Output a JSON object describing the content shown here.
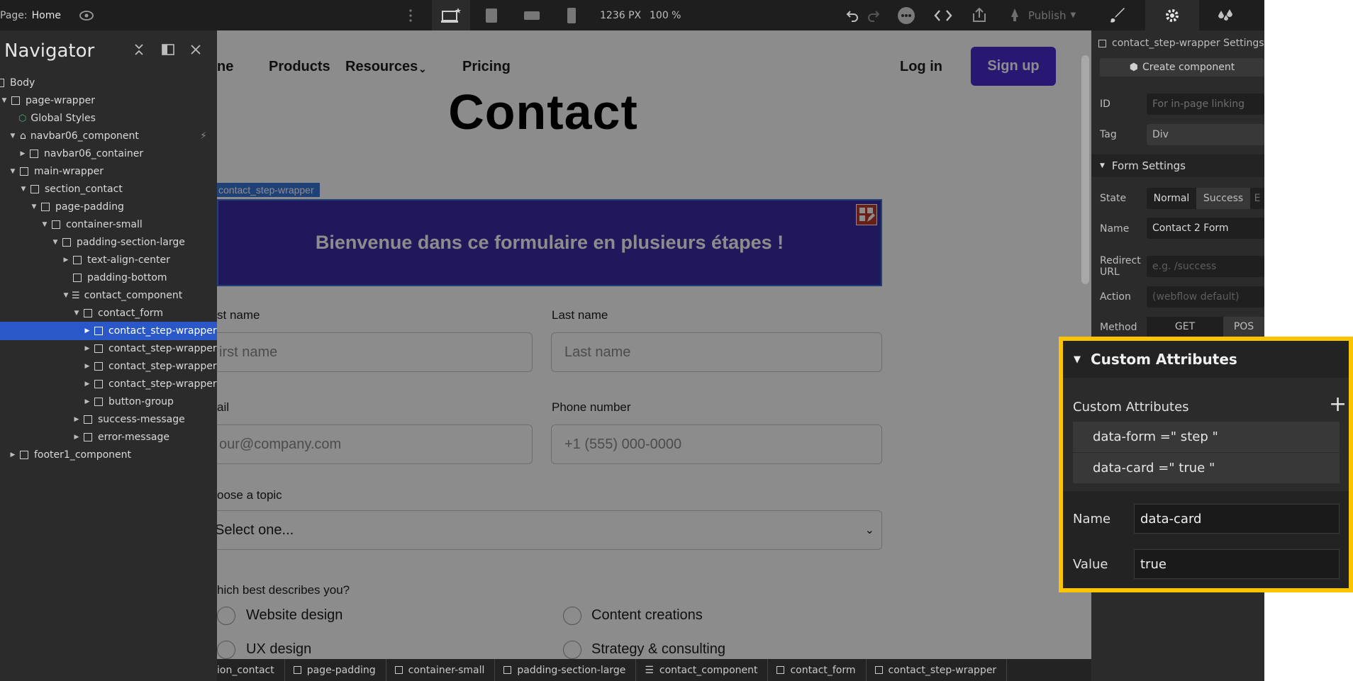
{
  "topbar": {
    "page_prefix": "Page:",
    "page_name": "Home",
    "width_label": "1236 PX",
    "zoom_label": "100 %",
    "publish_label": "Publish"
  },
  "navigator": {
    "title": "Navigator",
    "items": [
      {
        "label": "Body"
      },
      {
        "label": "page-wrapper"
      },
      {
        "label": "Global Styles"
      },
      {
        "label": "navbar06_component"
      },
      {
        "label": "navbar06_container"
      },
      {
        "label": "main-wrapper"
      },
      {
        "label": "section_contact"
      },
      {
        "label": "page-padding"
      },
      {
        "label": "container-small"
      },
      {
        "label": "padding-section-large"
      },
      {
        "label": "text-align-center"
      },
      {
        "label": "padding-bottom"
      },
      {
        "label": "contact_component"
      },
      {
        "label": "contact_form"
      },
      {
        "label": "contact_step-wrapper"
      },
      {
        "label": "contact_step-wrapper"
      },
      {
        "label": "contact_step-wrapper"
      },
      {
        "label": "contact_step-wrapper"
      },
      {
        "label": "button-group"
      },
      {
        "label": "success-message"
      },
      {
        "label": "error-message"
      },
      {
        "label": "footer1_component"
      }
    ]
  },
  "canvas": {
    "nav": {
      "home_partial": "ne",
      "products": "Products",
      "resources": "Resources",
      "pricing": "Pricing",
      "login": "Log in",
      "signup": "Sign up"
    },
    "heading": "Contact",
    "selected_tag": "contact_step-wrapper",
    "step_text": "Bienvenue dans ce formulaire en plusieurs étapes !",
    "first_name_label": "st name",
    "first_name_placeholder": "irst name",
    "last_name_label": "Last name",
    "last_name_placeholder": "Last name",
    "email_label": "ail",
    "email_placeholder": "our@company.com",
    "phone_label": "Phone number",
    "phone_placeholder": "+1 (555) 000-0000",
    "topic_label": "oose a topic",
    "topic_value": "Select one...",
    "describe_label": "hich best describes you?",
    "radios": [
      "Website design",
      "Content creations",
      "UX design",
      "Strategy & consulting"
    ]
  },
  "breadcrumbs": [
    "ion_contact",
    "page-padding",
    "container-small",
    "padding-section-large",
    "contact_component",
    "contact_form",
    "contact_step-wrapper"
  ],
  "settings": {
    "element_title": "contact_step-wrapper Settings",
    "create_component": "Create component",
    "id_label": "ID",
    "id_placeholder": "For in-page linking",
    "tag_label": "Tag",
    "tag_value": "Div",
    "form_settings": "Form Settings",
    "state_label": "State",
    "state_normal": "Normal",
    "state_success": "Success",
    "state_more": "E",
    "name_label": "Name",
    "name_value": "Contact 2 Form",
    "redirect_label_1": "Redirect",
    "redirect_label_2": "URL",
    "redirect_placeholder": "e.g. /success",
    "action_label": "Action",
    "action_placeholder": "(webflow default)",
    "method_label": "Method",
    "method_get": "GET",
    "method_post": "POS"
  },
  "custom_attributes": {
    "header": "Custom Attributes",
    "list_label": "Custom Attributes",
    "attrs": [
      "data-form =\" step \"",
      "data-card =\" true \""
    ],
    "name_label": "Name",
    "name_value": "data-card",
    "value_label": "Value",
    "value_value": "true"
  },
  "colors": {
    "highlight": "#fac400",
    "brand_purple": "#4c2ccf",
    "selection_blue": "#2b58c8"
  }
}
